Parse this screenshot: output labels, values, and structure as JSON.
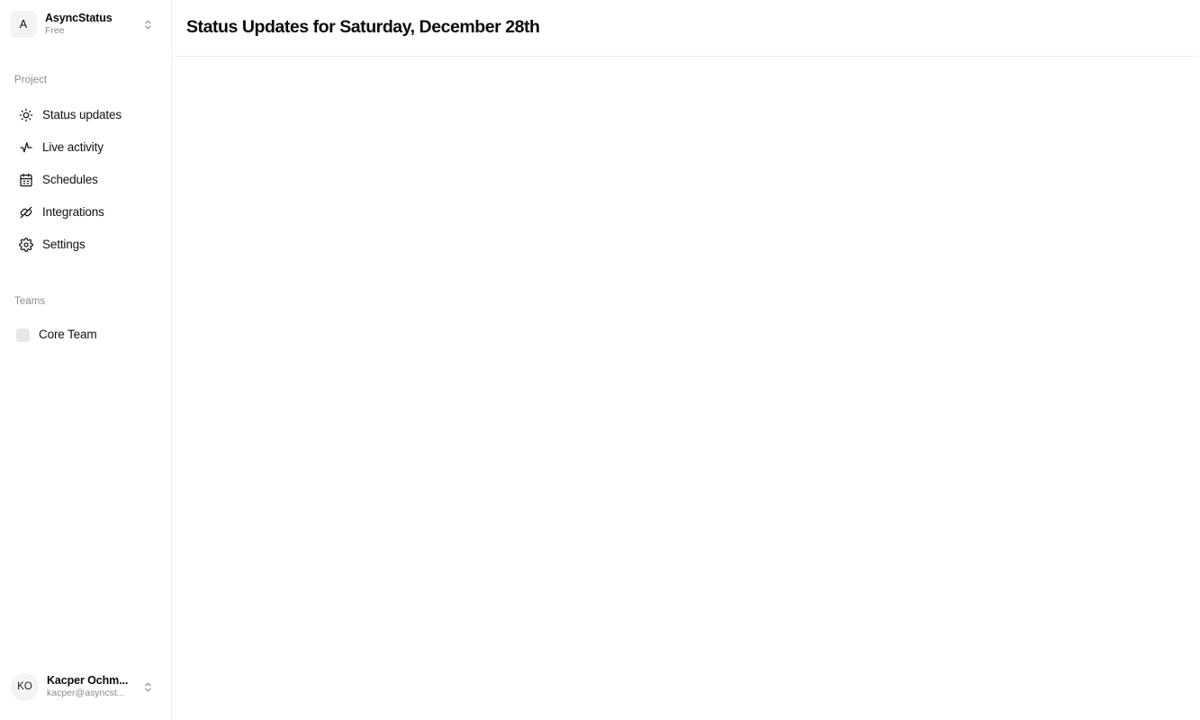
{
  "workspace": {
    "avatar_initial": "A",
    "name": "AsyncStatus",
    "plan": "Free",
    "switcher_icon": "chevron-up-down-icon"
  },
  "sidebar": {
    "project_section_label": "Project",
    "nav_items": [
      {
        "label": "Status updates",
        "icon": "sun-icon"
      },
      {
        "label": "Live activity",
        "icon": "activity-pulse-icon"
      },
      {
        "label": "Schedules",
        "icon": "calendar-icon"
      },
      {
        "label": "Integrations",
        "icon": "plug-icon"
      },
      {
        "label": "Settings",
        "icon": "gear-icon"
      }
    ],
    "teams_section_label": "Teams",
    "teams": [
      {
        "label": "Core Team"
      }
    ]
  },
  "user": {
    "avatar_initials": "KO",
    "name": "Kacper Ochm...",
    "email": "kacper@asyncst...",
    "switcher_icon": "chevron-up-down-icon"
  },
  "header": {
    "title": "Status Updates for Saturday, December 28th"
  },
  "colors": {
    "background": "#ffffff",
    "border": "#ededed",
    "text_primary": "#0a0a0a",
    "text_muted": "#8b8b8b",
    "avatar_bg": "#f4f4f4"
  }
}
